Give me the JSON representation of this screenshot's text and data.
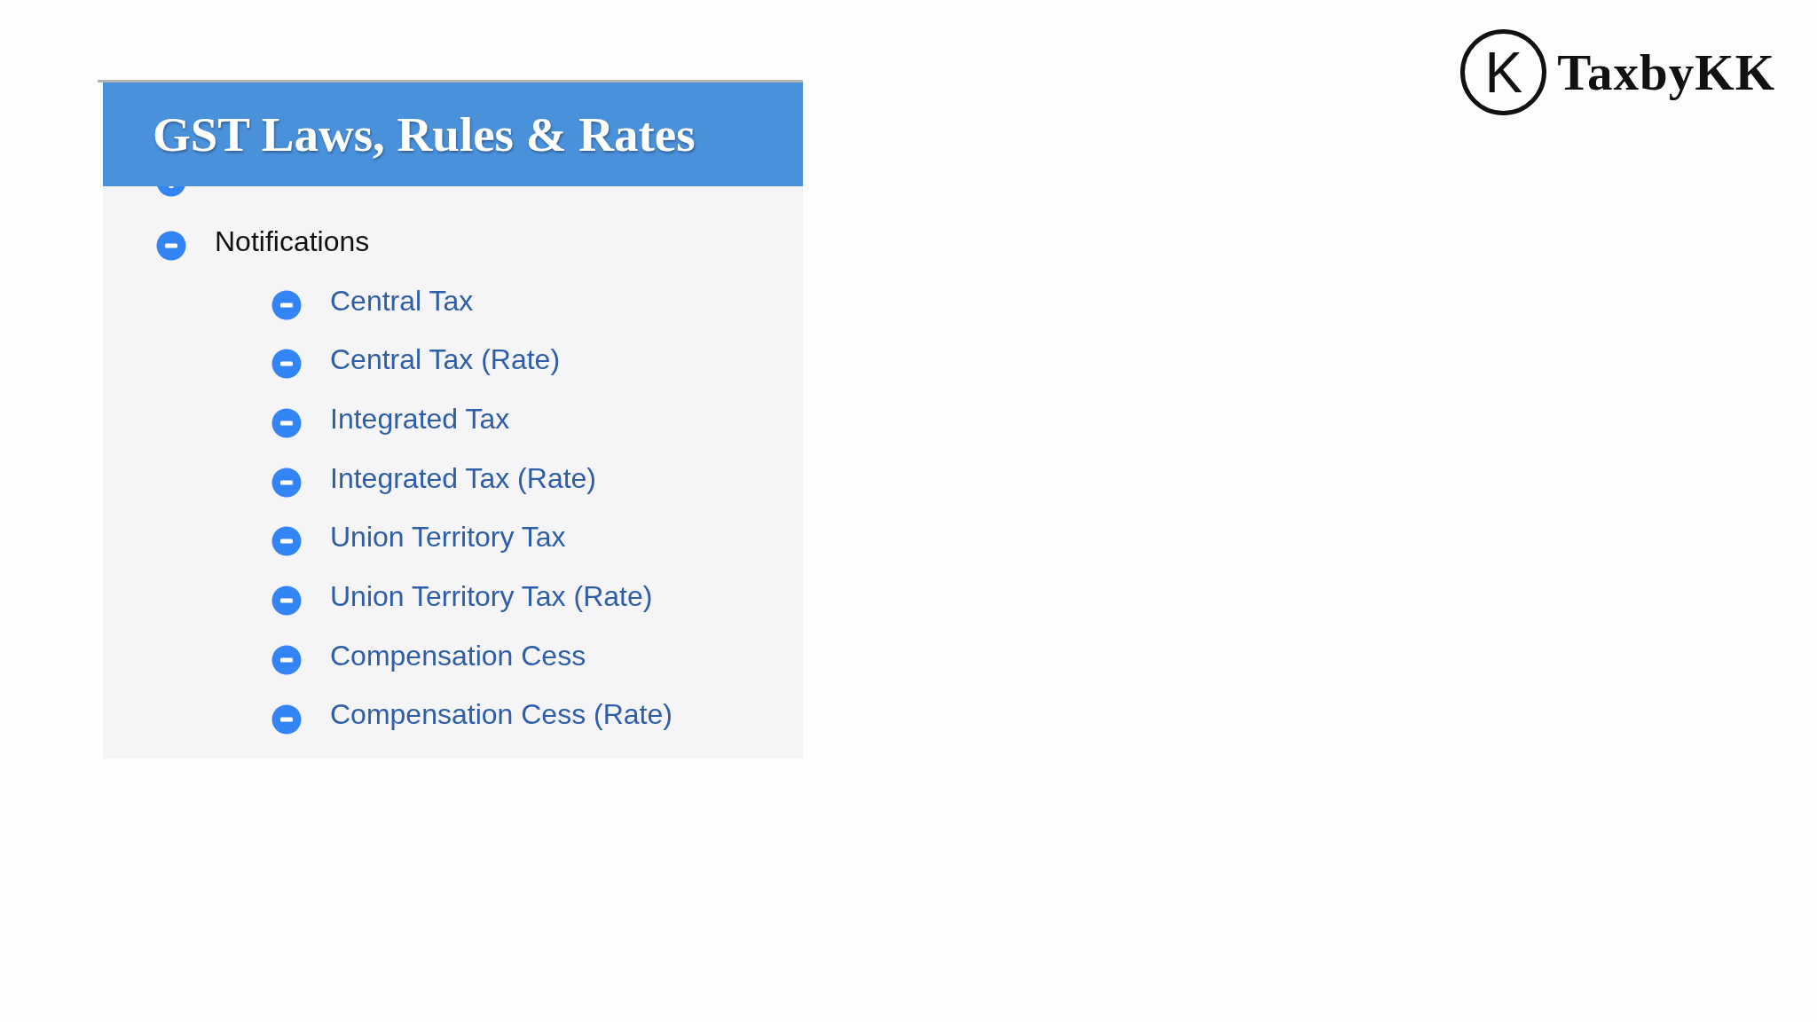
{
  "panel": {
    "title": "GST Laws, Rules & Rates",
    "tree": [
      {
        "expanded": false
      },
      {
        "label": "Notifications",
        "expanded": true,
        "children": [
          {
            "label": "Central Tax",
            "expanded": true
          },
          {
            "label": "Central Tax (Rate)",
            "expanded": true
          },
          {
            "label": "Integrated Tax",
            "expanded": true
          },
          {
            "label": "Integrated Tax (Rate)",
            "expanded": true
          },
          {
            "label": "Union Territory Tax",
            "expanded": true
          },
          {
            "label": "Union Territory Tax (Rate)",
            "expanded": true
          },
          {
            "label": "Compensation Cess",
            "expanded": true
          },
          {
            "label": "Compensation Cess (Rate)",
            "expanded": true
          }
        ]
      }
    ]
  },
  "logo": {
    "monogram": "K",
    "name": "TaxbyKK"
  }
}
